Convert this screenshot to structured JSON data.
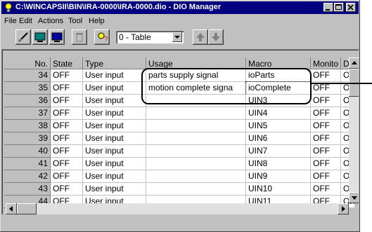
{
  "window": {
    "title": "C:\\WINCAPSII\\BIN\\IRA-0000\\IRA-0000.dio - DIO Manager"
  },
  "menu": [
    {
      "label": "File"
    },
    {
      "label": "Edit"
    },
    {
      "label": "Actions"
    },
    {
      "label": "Tool"
    },
    {
      "label": "Help"
    }
  ],
  "toolbar": {
    "view_select": "0 - Table"
  },
  "table": {
    "headers": [
      "No.",
      "State",
      "Type",
      "Usage",
      "Macro",
      "Monito",
      "Du"
    ],
    "rows": [
      {
        "no": "34",
        "state": "OFF",
        "type": "User input",
        "usage": "parts supply signal",
        "macro": "ioParts",
        "monitor": "OFF",
        "du": "ON"
      },
      {
        "no": "35",
        "state": "OFF",
        "type": "User input",
        "usage": "motion complete signa",
        "macro": "ioComplete",
        "monitor": "OFF",
        "du": "ON"
      },
      {
        "no": "36",
        "state": "OFF",
        "type": "User input",
        "usage": "",
        "macro": "UIN3",
        "monitor": "OFF",
        "du": "ON"
      },
      {
        "no": "37",
        "state": "OFF",
        "type": "User input",
        "usage": "",
        "macro": "UIN4",
        "monitor": "OFF",
        "du": "ON"
      },
      {
        "no": "38",
        "state": "OFF",
        "type": "User input",
        "usage": "",
        "macro": "UIN5",
        "monitor": "OFF",
        "du": "ON"
      },
      {
        "no": "39",
        "state": "OFF",
        "type": "User input",
        "usage": "",
        "macro": "UIN6",
        "monitor": "OFF",
        "du": "ON"
      },
      {
        "no": "40",
        "state": "OFF",
        "type": "User input",
        "usage": "",
        "macro": "UIN7",
        "monitor": "OFF",
        "du": "ON"
      },
      {
        "no": "41",
        "state": "OFF",
        "type": "User input",
        "usage": "",
        "macro": "UIN8",
        "monitor": "OFF",
        "du": "ON"
      },
      {
        "no": "42",
        "state": "OFF",
        "type": "User input",
        "usage": "",
        "macro": "UIN9",
        "monitor": "OFF",
        "du": "ON"
      },
      {
        "no": "43",
        "state": "OFF",
        "type": "User input",
        "usage": "",
        "macro": "UIN10",
        "monitor": "OFF",
        "du": "ON"
      },
      {
        "no": "44",
        "state": "OFF",
        "type": "User input",
        "usage": "",
        "macro": "UIN11",
        "monitor": "OFF",
        "du": "ON"
      }
    ]
  },
  "colors": {
    "title_bg": "#000080",
    "face": "#c0c0c0",
    "cell_bg": "#ffffff"
  }
}
